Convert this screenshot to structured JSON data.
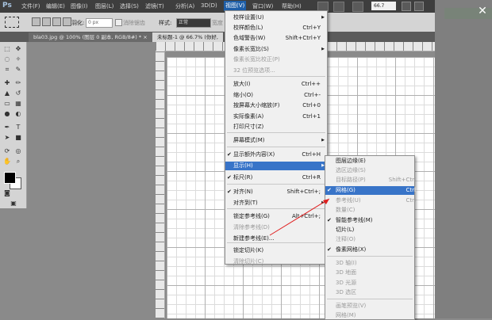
{
  "menubar": {
    "app": "Ps",
    "items": [
      "文件(F)",
      "编辑(E)",
      "图像(I)",
      "图层(L)",
      "选择(S)",
      "滤镜(T)",
      "3D(D)",
      "视图(V)",
      "窗口(W)",
      "帮助(H)"
    ],
    "zoom": "66.7"
  },
  "optbar": {
    "feather_label": "羽化:",
    "feather_value": "0 px",
    "antialias": "消除锯齿",
    "style_label": "样式:",
    "style_value": "正常",
    "width_label": "宽度"
  },
  "tabs": [
    {
      "label": "bla03.jpg @ 100% (图层 0 副本, RGB/8#) *",
      "close": "×"
    },
    {
      "label": "未标题-1 @ 66.7% (你好, ",
      "close": ""
    }
  ],
  "view_menu": [
    {
      "label": "校样设置(U)",
      "shortcut": "",
      "arrow": "▶",
      "check": "",
      "state": ""
    },
    {
      "label": "校样颜色(L)",
      "shortcut": "Ctrl+Y",
      "arrow": "",
      "check": "",
      "state": ""
    },
    {
      "label": "色域警告(W)",
      "shortcut": "Shift+Ctrl+Y",
      "arrow": "",
      "check": "",
      "state": ""
    },
    {
      "label": "像素长宽比(S)",
      "shortcut": "",
      "arrow": "▶",
      "check": "",
      "state": ""
    },
    {
      "label": "像素长宽比校正(P)",
      "shortcut": "",
      "arrow": "",
      "check": "",
      "state": "dis"
    },
    {
      "label": "32 位预览选项...",
      "shortcut": "",
      "arrow": "",
      "check": "",
      "state": "dis"
    },
    {
      "label": "放大(I)",
      "shortcut": "Ctrl++",
      "arrow": "",
      "check": "",
      "state": ""
    },
    {
      "label": "缩小(O)",
      "shortcut": "Ctrl+-",
      "arrow": "",
      "check": "",
      "state": ""
    },
    {
      "label": "按屏幕大小缩放(F)",
      "shortcut": "Ctrl+0",
      "arrow": "",
      "check": "",
      "state": ""
    },
    {
      "label": "实际像素(A)",
      "shortcut": "Ctrl+1",
      "arrow": "",
      "check": "",
      "state": ""
    },
    {
      "label": "打印尺寸(Z)",
      "shortcut": "",
      "arrow": "",
      "check": "",
      "state": ""
    },
    {
      "label": "屏幕模式(M)",
      "shortcut": "",
      "arrow": "▶",
      "check": "",
      "state": ""
    },
    {
      "label": "显示额外内容(X)",
      "shortcut": "Ctrl+H",
      "arrow": "",
      "check": "✔",
      "state": ""
    },
    {
      "label": "显示(H)",
      "shortcut": "",
      "arrow": "▶",
      "check": "",
      "state": "hl"
    },
    {
      "label": "标尺(R)",
      "shortcut": "Ctrl+R",
      "arrow": "",
      "check": "✔",
      "state": ""
    },
    {
      "label": "对齐(N)",
      "shortcut": "Shift+Ctrl+;",
      "arrow": "",
      "check": "✔",
      "state": ""
    },
    {
      "label": "对齐到(T)",
      "shortcut": "",
      "arrow": "▶",
      "check": "",
      "state": ""
    },
    {
      "label": "锁定参考线(G)",
      "shortcut": "Alt+Ctrl+;",
      "arrow": "",
      "check": "",
      "state": ""
    },
    {
      "label": "清除参考线(D)",
      "shortcut": "",
      "arrow": "",
      "check": "",
      "state": "dis"
    },
    {
      "label": "新建参考线(E)...",
      "shortcut": "",
      "arrow": "",
      "check": "",
      "state": ""
    },
    {
      "label": "锁定切片(K)",
      "shortcut": "",
      "arrow": "",
      "check": "",
      "state": ""
    },
    {
      "label": "清除切片(C)",
      "shortcut": "",
      "arrow": "",
      "check": "",
      "state": "dis"
    }
  ],
  "show_menu": [
    {
      "label": "图层边缘(E)",
      "shortcut": "",
      "check": "",
      "state": ""
    },
    {
      "label": "选区边缘(S)",
      "shortcut": "",
      "check": "",
      "state": "dis"
    },
    {
      "label": "目标路径(P)",
      "shortcut": "Shift+Ctrl",
      "check": "",
      "state": "dis"
    },
    {
      "label": "网格(G)",
      "shortcut": "Ctrl",
      "check": "✔",
      "state": "hl"
    },
    {
      "label": "参考线(U)",
      "shortcut": "Ctrl",
      "check": "",
      "state": "dis"
    },
    {
      "label": "数量(C)",
      "shortcut": "",
      "check": "",
      "state": "dis"
    },
    {
      "label": "智能参考线(M)",
      "shortcut": "",
      "check": "✔",
      "state": ""
    },
    {
      "label": "切片(L)",
      "shortcut": "",
      "check": "",
      "state": ""
    },
    {
      "label": "注释(O)",
      "shortcut": "",
      "check": "",
      "state": "dis"
    },
    {
      "label": "像素网格(X)",
      "shortcut": "",
      "check": "✔",
      "state": ""
    },
    {
      "label": "3D 轴(I)",
      "shortcut": "",
      "check": "",
      "state": "dis"
    },
    {
      "label": "3D 地面",
      "shortcut": "",
      "check": "",
      "state": "dis"
    },
    {
      "label": "3D 光源",
      "shortcut": "",
      "check": "",
      "state": "dis"
    },
    {
      "label": "3D 选区",
      "shortcut": "",
      "check": "",
      "state": "dis"
    },
    {
      "label": "画笔预览(V)",
      "shortcut": "",
      "check": "",
      "state": "dis"
    },
    {
      "label": "网格(M)",
      "shortcut": "",
      "check": "",
      "state": "dis"
    }
  ],
  "colors": {
    "highlight": "#3874c8",
    "annotation": "#e02020"
  }
}
